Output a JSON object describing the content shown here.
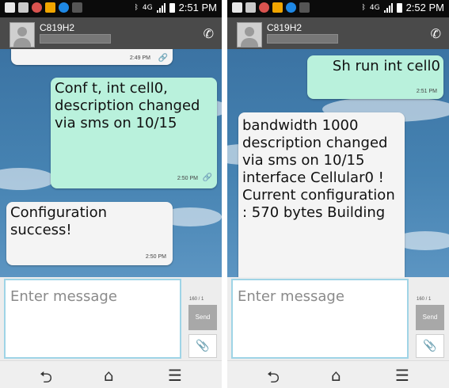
{
  "left": {
    "status": {
      "time": "2:51 PM",
      "network": "4G"
    },
    "contact": {
      "name": "C819H2"
    },
    "messages": [
      {
        "dir": "sent",
        "text": "",
        "time": "2:49 PM"
      },
      {
        "dir": "sent",
        "text": "Conf t, int cell0, description changed via sms on 10/15",
        "time": "2:50 PM"
      },
      {
        "dir": "recv",
        "text": "Configuration success!",
        "time": "2:50 PM"
      }
    ],
    "input": {
      "placeholder": "Enter message",
      "counter": "160 / 1",
      "send": "Send"
    }
  },
  "right": {
    "status": {
      "time": "2:52 PM",
      "network": "4G"
    },
    "contact": {
      "name": "C819H2"
    },
    "messages": [
      {
        "dir": "sent",
        "text": "Sh run int cell0",
        "time": "2:51 PM"
      },
      {
        "dir": "recv",
        "text": "bandwidth 1000 description changed via sms on 10/15 interface Cellular0 ! Current configuration : 570 bytes Building",
        "time": ""
      }
    ],
    "input": {
      "placeholder": "Enter message",
      "counter": "160 / 1",
      "send": "Send"
    }
  }
}
